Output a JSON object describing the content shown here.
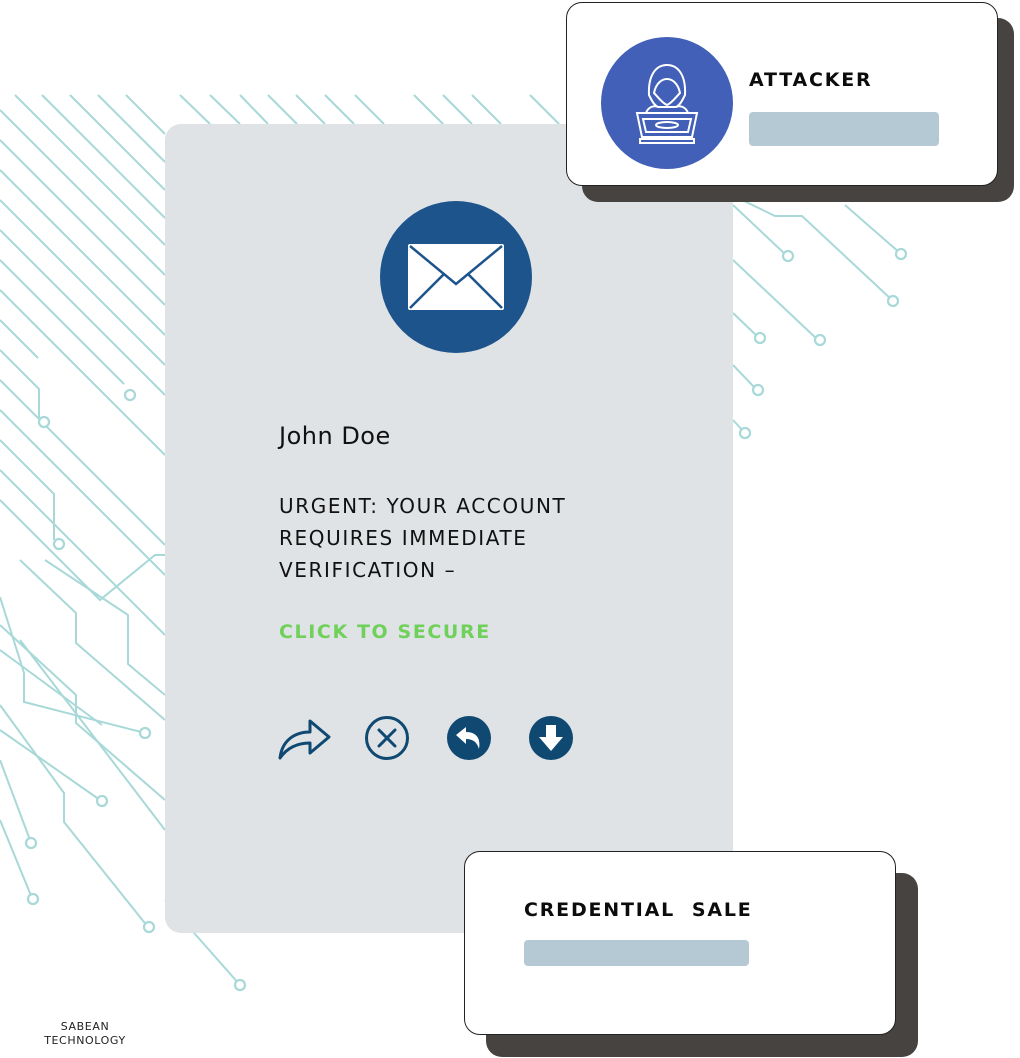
{
  "email": {
    "icon": "envelope-icon",
    "sender": "John Doe",
    "subject_lines": [
      "URGENT: YOUR ACCOUNT",
      "REQUIRES IMMEDIATE",
      "VERIFICATION –"
    ],
    "cta": "CLICK TO SECURE",
    "actions": [
      {
        "name": "forward",
        "icon": "forward-arrow-icon"
      },
      {
        "name": "delete",
        "icon": "close-circle-icon"
      },
      {
        "name": "reply",
        "icon": "reply-circle-icon"
      },
      {
        "name": "download",
        "icon": "download-circle-icon"
      }
    ]
  },
  "attacker_card": {
    "icon": "hooded-hacker-laptop-icon",
    "label": "ATTACKER"
  },
  "sale_card": {
    "label": "CREDENTIAL  SALE"
  },
  "brand": {
    "line1": "SABEAN",
    "line2": "TECHNOLOGY"
  },
  "colors": {
    "circuit": "#a8d8d8",
    "email_card_bg": "#dfe3e6",
    "mail_icon_bg": "#1d548c",
    "attacker_icon_bg": "#4260b8",
    "cta_green": "#6fd15a",
    "placeholder_bar": "#b5c9d4",
    "shadow": "#474340",
    "action_icon": "#0f4870"
  }
}
